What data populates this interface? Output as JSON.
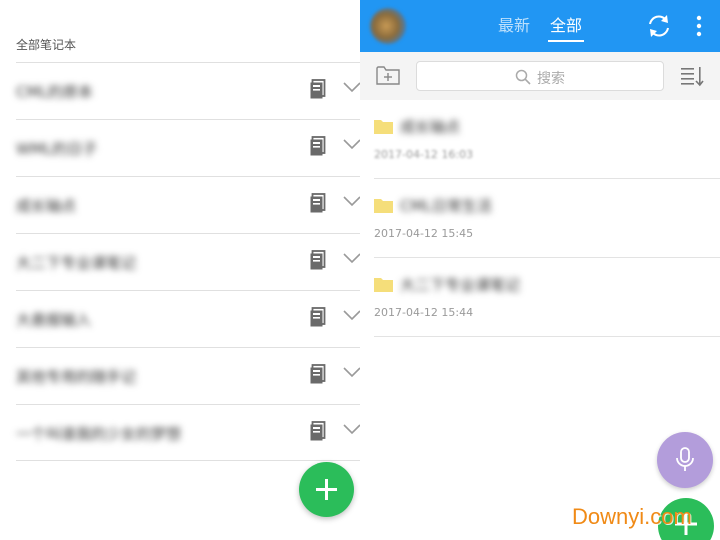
{
  "left": {
    "section_label": "全部笔记本",
    "notebooks": [
      {
        "name": "CML的原本"
      },
      {
        "name": "WML的日子"
      },
      {
        "name": "成长轴点"
      },
      {
        "name": "大二下专业课笔记"
      },
      {
        "name": "大悬报输入"
      },
      {
        "name": "其他专用的随手记"
      },
      {
        "name": "一个叫谁我的少女的梦想"
      }
    ],
    "row_icons": {
      "doc": "notebook-doc-icon",
      "chevron": "chevron-down-icon"
    },
    "fab_icon": "plus-icon"
  },
  "right": {
    "tabs": {
      "latest": "最新",
      "all": "全部"
    },
    "active_tab": "全部",
    "search": {
      "placeholder": "搜索"
    },
    "folders": [
      {
        "name": "成长轴点",
        "date": "2017-04-12 16:03"
      },
      {
        "name": "CML日常生活",
        "date": "2017-04-12 15:45"
      },
      {
        "name": "大二下专业课笔记",
        "date": "2017-04-12 15:44"
      }
    ],
    "icons": [
      "avatar",
      "sync-icon",
      "more-icon",
      "new-folder-icon",
      "search-icon",
      "sort-icon",
      "folder-icon",
      "mic-icon",
      "plus-icon"
    ]
  },
  "watermark": "Downyi.com",
  "colors": {
    "top_bar": "#2196f3",
    "fab_green": "#2bbd5a",
    "fab_purple": "#b39ddb",
    "folder": "#f5de7a",
    "watermark": "#f08a16"
  }
}
